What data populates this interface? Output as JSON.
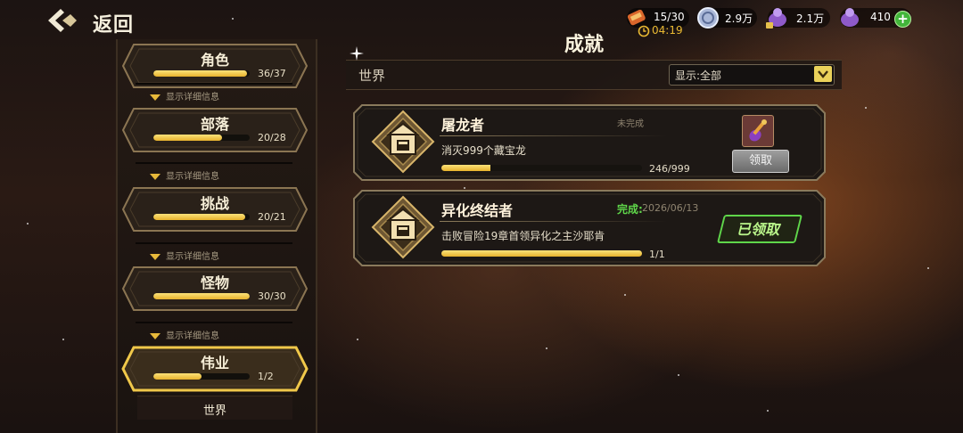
{
  "header": {
    "back_label": "返回",
    "title": "成就"
  },
  "resources": [
    {
      "icon": "stamina-scroll-icon",
      "value": "15/30",
      "timer": "04:19"
    },
    {
      "icon": "silver-coin-icon",
      "value": "2.9万"
    },
    {
      "icon": "locked-gem-bag-icon",
      "value": "2.1万"
    },
    {
      "icon": "purple-gem-bag-icon",
      "value": "410"
    }
  ],
  "categories": [
    {
      "name": "角色",
      "progress": "36/37",
      "fill": 0.973,
      "detail": "显示详细信息"
    },
    {
      "name": "部落",
      "progress": "20/28",
      "fill": 0.714,
      "detail": "显示详细信息"
    },
    {
      "name": "挑战",
      "progress": "20/21",
      "fill": 0.952,
      "detail": "显示详细信息"
    },
    {
      "name": "怪物",
      "progress": "30/30",
      "fill": 1.0,
      "detail": "显示详细信息"
    },
    {
      "name": "伟业",
      "progress": "1/2",
      "fill": 0.5,
      "detail": "显示详细信息"
    }
  ],
  "sub_item": {
    "label": "世界"
  },
  "filter": {
    "section": "世界",
    "value": "显示:全部"
  },
  "achievements": [
    {
      "title": "屠龙者",
      "status": "未完成",
      "description": "消灭999个藏宝龙",
      "progress": "246/999",
      "fill": 0.246,
      "action": "领取"
    },
    {
      "title": "异化终结者",
      "status": "完成:",
      "date": "2026/06/13",
      "description": "击败冒险19章首领异化之主沙耶肯",
      "progress": "1/1",
      "fill": 1.0,
      "action": "已领取"
    }
  ],
  "colors": {
    "gold": "#e7b22c",
    "complete_green": "#5fd64a",
    "frame": "#7a6a4e"
  }
}
